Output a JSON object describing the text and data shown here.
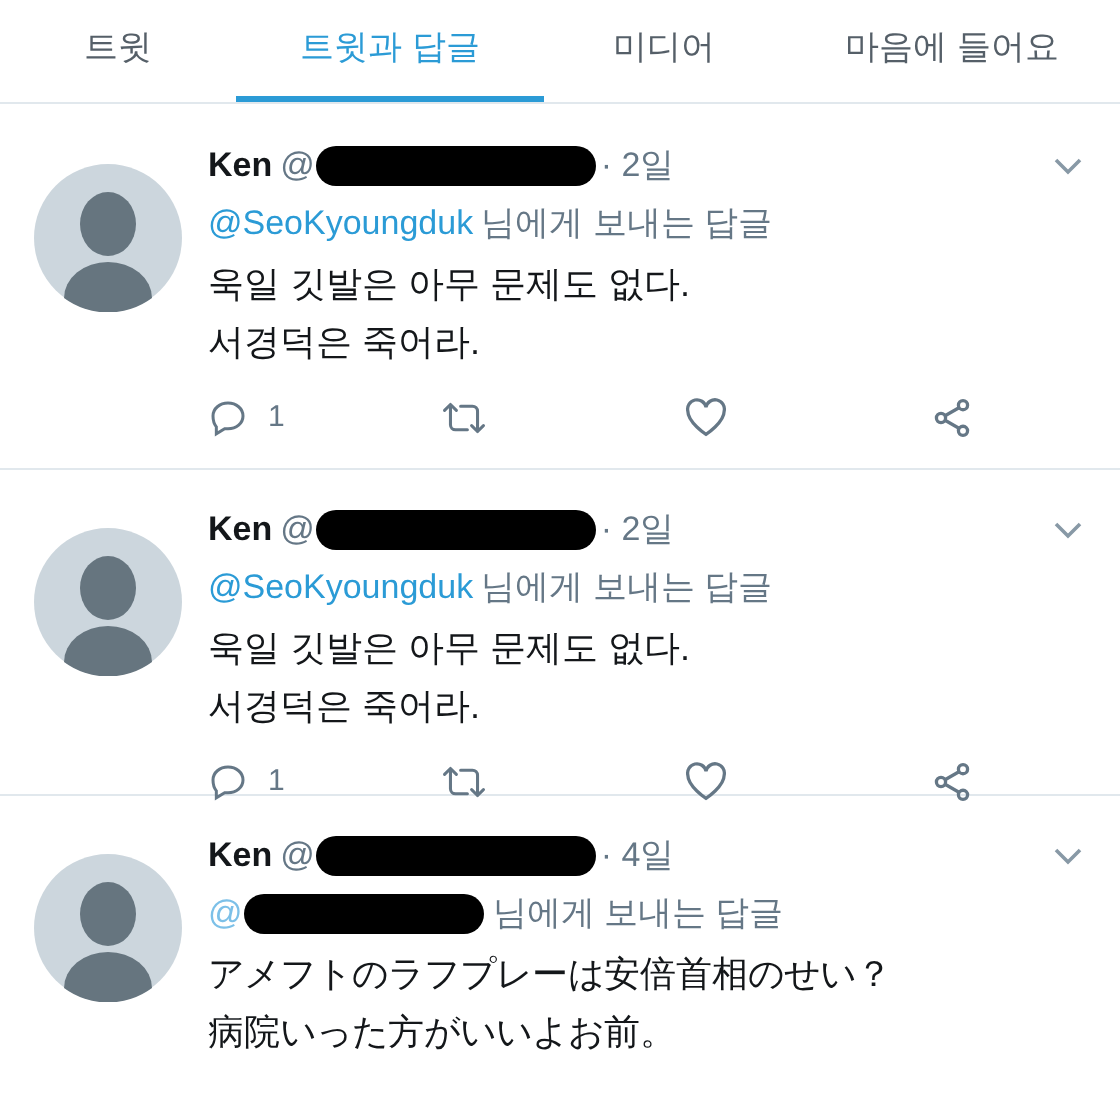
{
  "tabs": [
    {
      "label": "트윗",
      "selected": false
    },
    {
      "label": "트윗과 답글",
      "selected": true
    },
    {
      "label": "미디어",
      "selected": false
    },
    {
      "label": "마음에 들어요",
      "selected": false
    }
  ],
  "tweets": [
    {
      "name": "Ken",
      "handle": "@",
      "handle_redacted": true,
      "time": "· 2일",
      "mention": "@SeoKyoungduk",
      "mention_redacted": false,
      "reply_label": "님에게 보내는 답글",
      "lines": [
        "욱일 깃발은 아무 문제도 없다.",
        "서경덕은 죽어라."
      ],
      "actions": {
        "reply_count": "1"
      }
    },
    {
      "name": "Ken",
      "handle": "@",
      "handle_redacted": true,
      "time": "· 2일",
      "mention": "@SeoKyoungduk",
      "mention_redacted": false,
      "reply_label": "님에게 보내는 답글",
      "lines": [
        "욱일 깃발은 아무 문제도 없다.",
        "서경덕은 죽어라."
      ],
      "actions": {
        "reply_count": "1"
      }
    },
    {
      "name": "Ken",
      "handle": "@",
      "handle_redacted": true,
      "time": "· 4일",
      "mention": "@",
      "mention_redacted": true,
      "reply_label": "님에게 보내는 답글",
      "lines": [
        "アメフトのラフプレーは安倍首相のせい？",
        "病院いった方がいいよお前。"
      ]
    }
  ]
}
